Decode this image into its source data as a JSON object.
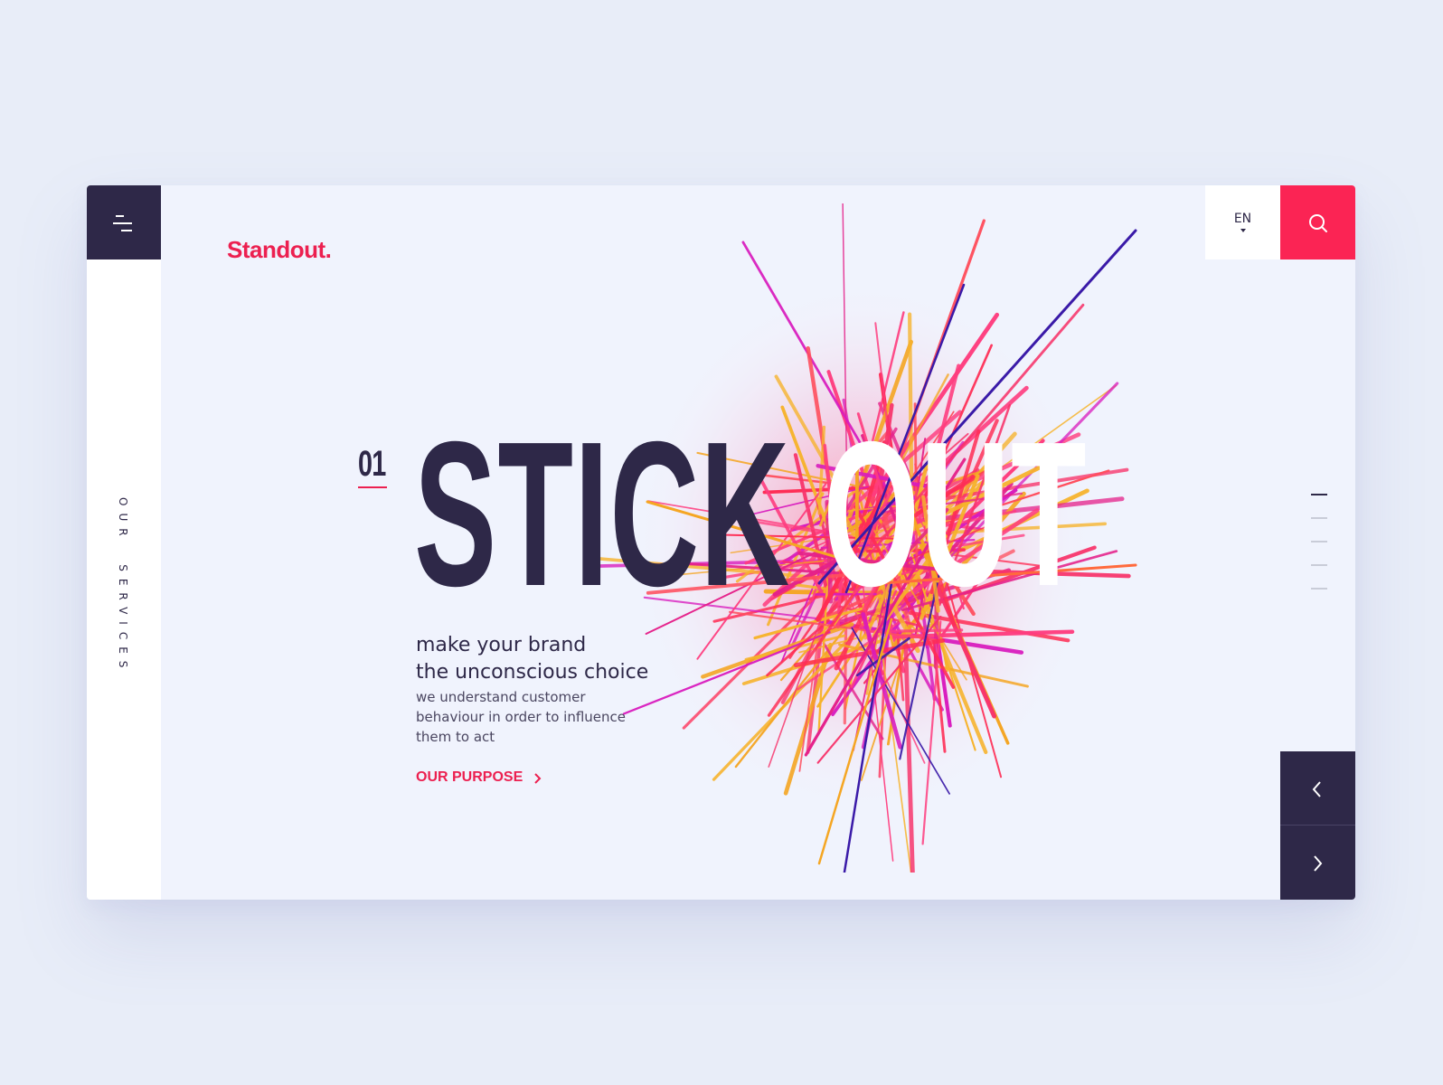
{
  "brand": {
    "logo": "Standout.",
    "accent_color": "#ec2050",
    "dark_color": "#2e2848"
  },
  "header": {
    "menu_icon": "hamburger-menu-icon",
    "language": "EN",
    "search_icon": "search-icon"
  },
  "sidebar": {
    "vertical_label": "OUR  SERVICES"
  },
  "hero": {
    "slide_number": "01",
    "headline_word1": "STICK",
    "headline_word2": "OUT",
    "subheading_line1": "make your brand",
    "subheading_line2": "the unconscious choice",
    "description_line1": "we understand customer",
    "description_line2": "behaviour in order to influence",
    "description_line3": "them to act",
    "cta_label": "OUR PURPOSE",
    "cta_icon": "chevron-right-icon"
  },
  "slider": {
    "indicator_count": 5,
    "active_index": 0,
    "prev_icon": "chevron-left-icon",
    "next_icon": "chevron-right-icon"
  }
}
